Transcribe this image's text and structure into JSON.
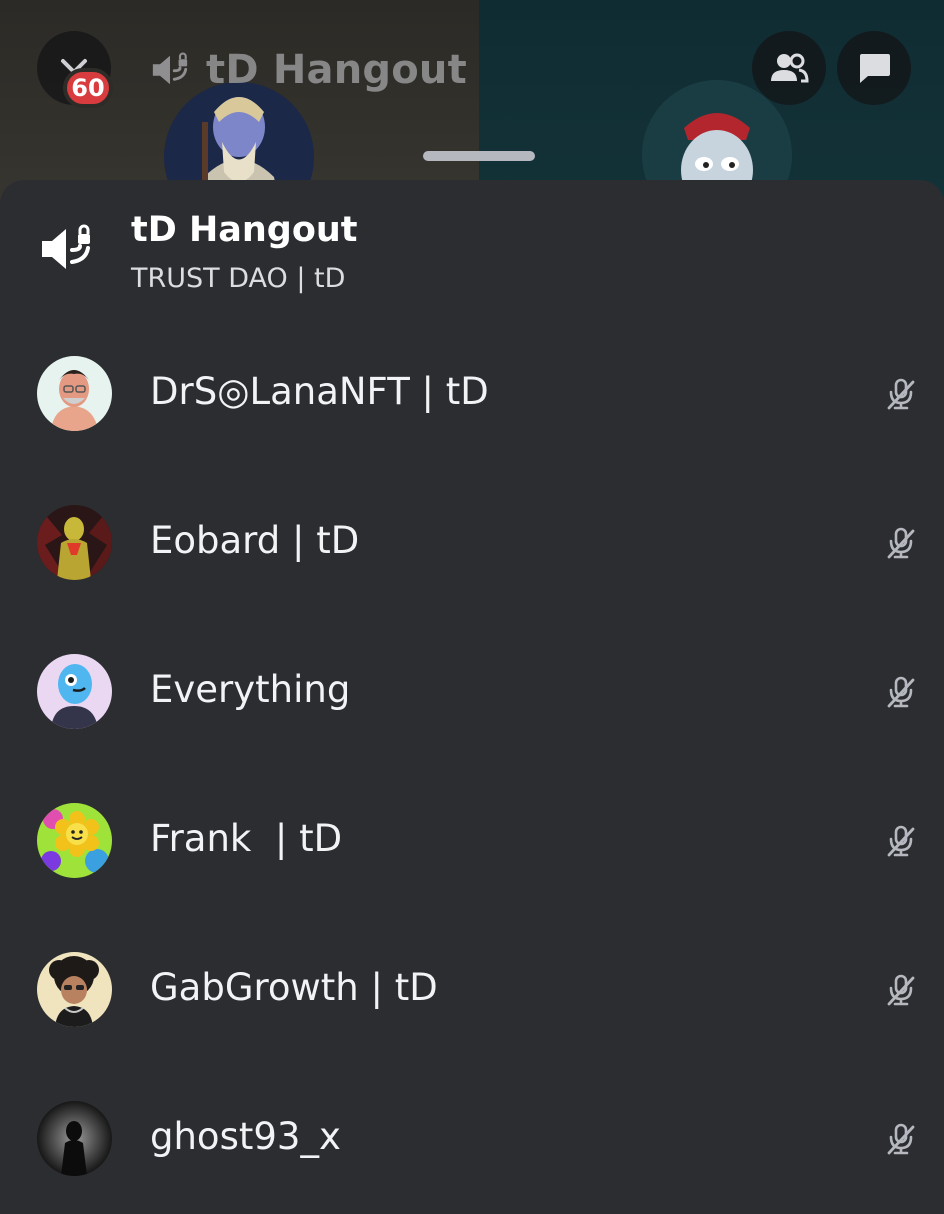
{
  "stage": {
    "channel_name": "tD Hangout",
    "notification_count": "60"
  },
  "header": {
    "title": "tD Hangout",
    "subtitle": "TRUST DAO | tD"
  },
  "participants": [
    {
      "name": "DrS◎LanaNFT | tD",
      "muted": true
    },
    {
      "name": "Eobard | tD",
      "muted": true
    },
    {
      "name": "Everything",
      "muted": true
    },
    {
      "name": "Frank  | tD",
      "muted": true
    },
    {
      "name": "GabGrowth | tD",
      "muted": true
    },
    {
      "name": "ghost93_x",
      "muted": true
    }
  ],
  "icons": {
    "voice_channel": "voice-locked-icon",
    "mute": "mic-off-icon",
    "members": "people-icon",
    "chat": "chat-bubble-icon",
    "back": "back-icon"
  },
  "colors": {
    "sheet_bg": "#2b2d31",
    "badge": "#d83c3e",
    "muted_icon": "#b5b9bf"
  }
}
